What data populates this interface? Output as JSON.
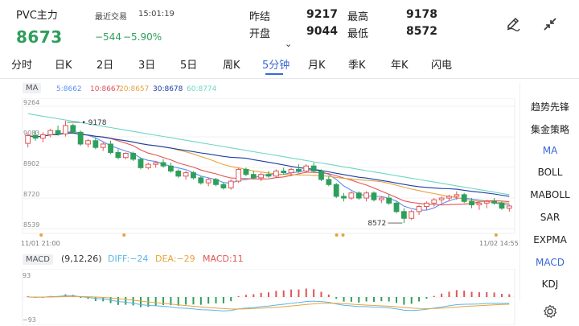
{
  "header": {
    "title": "PVC主力",
    "last_trade_label": "最近交易",
    "last_trade_time": "15:01:19",
    "price": "8673",
    "change": "−544",
    "change_pct": "−5.90%",
    "stats": [
      {
        "label": "昨结",
        "value": "9217"
      },
      {
        "label": "最高",
        "value": "9178"
      },
      {
        "label": "开盘",
        "value": "9044"
      },
      {
        "label": "最低",
        "value": "8572"
      }
    ]
  },
  "tools": {
    "draw_icon": "pen-icon",
    "shrink_icon": "collapse-arrows-icon"
  },
  "tabs": [
    {
      "label": "分时"
    },
    {
      "label": "日K"
    },
    {
      "label": "2日"
    },
    {
      "label": "3日"
    },
    {
      "label": "5日"
    },
    {
      "label": "周K"
    },
    {
      "label": "5分钟",
      "active": true
    },
    {
      "label": "月K"
    },
    {
      "label": "季K"
    },
    {
      "label": "年K"
    },
    {
      "label": "闪电"
    }
  ],
  "ma_legend": {
    "badge": "MA",
    "items": [
      {
        "text": "5:8662",
        "color": "#5b8ff9"
      },
      {
        "text": "10:8667",
        "color": "#e05555"
      },
      {
        "text": "20:8657",
        "color": "#e8a33d"
      },
      {
        "text": "30:8678",
        "color": "#1a3fa6"
      },
      {
        "text": "60:8774",
        "color": "#6fd6c4"
      }
    ]
  },
  "chart_data": {
    "type": "candlestick",
    "y_ticks": [
      "9264",
      "9083",
      "8902",
      "8720",
      "8539"
    ],
    "ylim": [
      8539,
      9264
    ],
    "x_start_label": "11/01 21:00",
    "x_end_label": "11/02 14:55",
    "high_annotation": "9178",
    "low_annotation": "8572",
    "candles": [
      [
        9044,
        9100,
        9020,
        9090
      ],
      [
        9090,
        9120,
        9060,
        9075
      ],
      [
        9075,
        9110,
        9050,
        9095
      ],
      [
        9095,
        9130,
        9080,
        9120
      ],
      [
        9120,
        9150,
        9090,
        9100
      ],
      [
        9100,
        9178,
        9085,
        9150
      ],
      [
        9150,
        9160,
        9100,
        9110
      ],
      [
        9110,
        9120,
        9030,
        9040
      ],
      [
        9040,
        9070,
        9020,
        9060
      ],
      [
        9060,
        9080,
        9010,
        9020
      ],
      [
        9020,
        9050,
        9000,
        9040
      ],
      [
        9040,
        9060,
        8980,
        8990
      ],
      [
        8990,
        9010,
        8950,
        8960
      ],
      [
        8960,
        8990,
        8950,
        8985
      ],
      [
        8985,
        8995,
        8940,
        8950
      ],
      [
        8950,
        8960,
        8890,
        8900
      ],
      [
        8900,
        8930,
        8890,
        8920
      ],
      [
        8920,
        8940,
        8900,
        8930
      ],
      [
        8930,
        8950,
        8900,
        8910
      ],
      [
        8910,
        8930,
        8870,
        8880
      ],
      [
        8880,
        8890,
        8840,
        8850
      ],
      [
        8850,
        8880,
        8830,
        8870
      ],
      [
        8870,
        8880,
        8830,
        8840
      ],
      [
        8840,
        8850,
        8800,
        8810
      ],
      [
        8810,
        8840,
        8790,
        8830
      ],
      [
        8830,
        8840,
        8790,
        8800
      ],
      [
        8800,
        8810,
        8770,
        8780
      ],
      [
        8780,
        8830,
        8770,
        8820
      ],
      [
        8820,
        8900,
        8810,
        8890
      ],
      [
        8890,
        8900,
        8850,
        8860
      ],
      [
        8860,
        8880,
        8830,
        8840
      ],
      [
        8840,
        8870,
        8820,
        8860
      ],
      [
        8860,
        8880,
        8840,
        8850
      ],
      [
        8850,
        8890,
        8840,
        8880
      ],
      [
        8880,
        8900,
        8860,
        8870
      ],
      [
        8870,
        8900,
        8850,
        8890
      ],
      [
        8890,
        8920,
        8870,
        8880
      ],
      [
        8880,
        8920,
        8870,
        8910
      ],
      [
        8910,
        8930,
        8870,
        8880
      ],
      [
        8880,
        8890,
        8820,
        8830
      ],
      [
        8830,
        8850,
        8790,
        8800
      ],
      [
        8800,
        8810,
        8720,
        8730
      ],
      [
        8730,
        8750,
        8700,
        8720
      ],
      [
        8720,
        8760,
        8710,
        8750
      ],
      [
        8750,
        8760,
        8710,
        8720
      ],
      [
        8720,
        8760,
        8700,
        8750
      ],
      [
        8750,
        8760,
        8700,
        8710
      ],
      [
        8710,
        8730,
        8690,
        8720
      ],
      [
        8720,
        8740,
        8680,
        8690
      ],
      [
        8690,
        8700,
        8630,
        8640
      ],
      [
        8640,
        8660,
        8572,
        8600
      ],
      [
        8600,
        8650,
        8590,
        8640
      ],
      [
        8640,
        8680,
        8620,
        8670
      ],
      [
        8670,
        8700,
        8650,
        8690
      ],
      [
        8690,
        8720,
        8670,
        8710
      ],
      [
        8710,
        8730,
        8690,
        8720
      ],
      [
        8720,
        8740,
        8700,
        8730
      ],
      [
        8730,
        8760,
        8710,
        8740
      ],
      [
        8740,
        8750,
        8690,
        8700
      ],
      [
        8700,
        8720,
        8660,
        8680
      ],
      [
        8680,
        8700,
        8650,
        8690
      ],
      [
        8690,
        8710,
        8660,
        8700
      ],
      [
        8700,
        8720,
        8680,
        8690
      ],
      [
        8690,
        8700,
        8650,
        8660
      ],
      [
        8660,
        8680,
        8640,
        8673
      ]
    ],
    "markers": [
      8,
      47,
      147,
      150,
      222
    ]
  },
  "macd": {
    "badge": "MACD",
    "params": "(9,12,26)",
    "diff": "DIFF:−24",
    "dea": "DEA:−29",
    "macd": "MACD:11",
    "y_top": "93",
    "y_bottom": "−93"
  },
  "side_menu": [
    {
      "label": "趋势先锋"
    },
    {
      "label": "集金策略"
    },
    {
      "label": "MA",
      "active": true
    },
    {
      "label": "BOLL"
    },
    {
      "label": "MABOLL"
    },
    {
      "label": "SAR"
    },
    {
      "label": "EXPMA"
    },
    {
      "label": "MACD",
      "active": true
    },
    {
      "label": "KDJ"
    }
  ]
}
